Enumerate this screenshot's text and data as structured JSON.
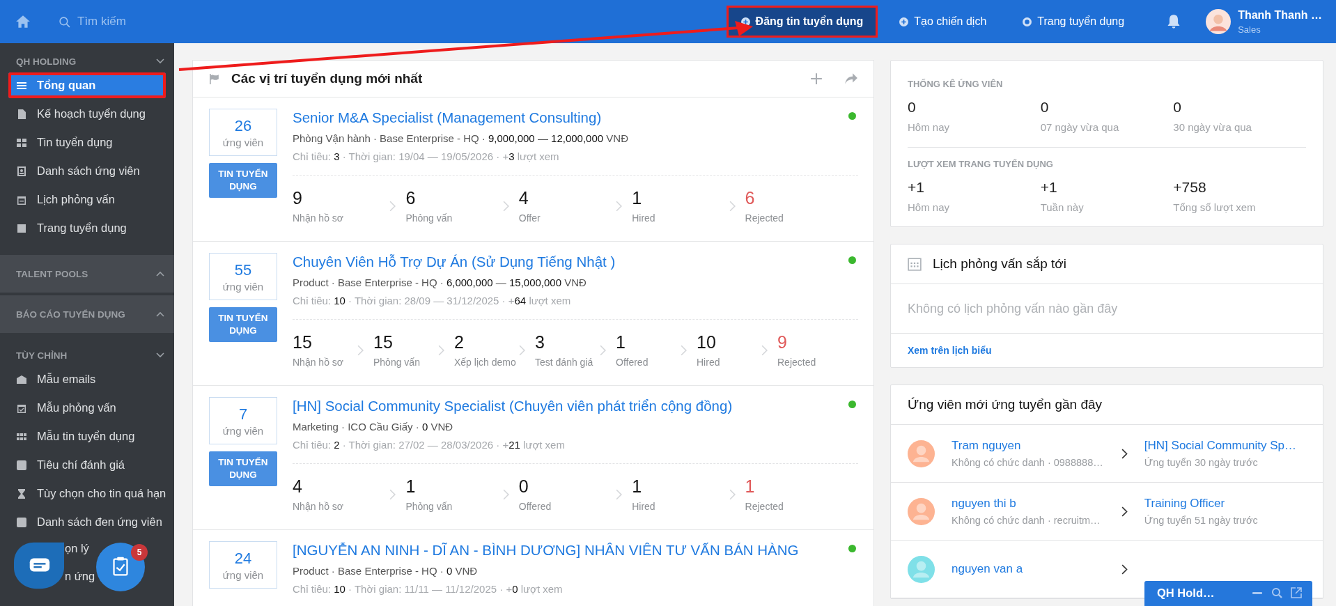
{
  "topbar": {
    "search": {
      "placeholder": "Tìm kiếm"
    },
    "actions": [
      {
        "label": "Đăng tin tuyển dụng",
        "highlighted": true
      },
      {
        "label": "Tạo chiến dịch",
        "highlighted": false
      },
      {
        "label": "Trang tuyển dụng",
        "highlighted": false
      }
    ],
    "user": {
      "name": "Thanh Thanh …",
      "role": "Sales"
    }
  },
  "sidebar": {
    "sections": [
      {
        "title": "QH HOLDING",
        "expanded": true,
        "items": [
          {
            "label": "Tổng quan",
            "kind": "full",
            "selected": true,
            "highlighted": true
          },
          {
            "label": "Kế hoạch tuyển dụng",
            "kind": "full",
            "selected": false,
            "highlighted": false
          },
          {
            "label": "Tin tuyển dụng",
            "kind": "full",
            "selected": false,
            "highlighted": false
          },
          {
            "label": "Danh sách ứng viên",
            "kind": "full",
            "selected": false,
            "highlighted": false
          },
          {
            "label": "Lịch phỏng vấn",
            "kind": "full",
            "selected": false,
            "highlighted": false
          },
          {
            "label": "Trang tuyển dụng",
            "kind": "full",
            "selected": false,
            "highlighted": false
          }
        ]
      },
      {
        "title": "TALENT POOLS",
        "expanded": false
      },
      {
        "title": "BÁO CÁO TUYỂN DỤNG",
        "expanded": false
      },
      {
        "title": "TÙY CHỈNH",
        "expanded": true,
        "items": [
          {
            "label": "Mẫu emails",
            "kind": "full",
            "selected": false,
            "highlighted": false
          },
          {
            "label": "Mẫu phỏng vấn",
            "kind": "full",
            "selected": false,
            "highlighted": false
          },
          {
            "label": "Mẫu tin tuyển dụng",
            "kind": "full",
            "selected": false,
            "highlighted": false
          },
          {
            "label": "Tiêu chí đánh giá",
            "kind": "full",
            "selected": false,
            "highlighted": false
          },
          {
            "label": "Tùy chọn cho tin quá hạn",
            "kind": "full",
            "selected": false,
            "highlighted": false
          },
          {
            "label": "Danh sách đen ứng viên",
            "kind": "full",
            "selected": false,
            "highlighted": false
          },
          {
            "label": "ọn lý",
            "kind": "partial",
            "selected": false,
            "highlighted": false
          },
          {
            "label": "n ứng",
            "kind": "partial",
            "selected": false,
            "highlighted": false
          }
        ]
      }
    ]
  },
  "jobs": {
    "title": "Các vị trí tuyển dụng mới nhất",
    "items": [
      {
        "count": "26",
        "count_label": "ứng viên",
        "button": "TIN TUYỂN DỤNG",
        "title": "Senior M&A Specialist (Management Consulting)",
        "active": true,
        "meta": "Phòng Vận hành · Base Enterprise - HQ · **9,000,000** — **12,000,000** VNĐ",
        "details": "Chỉ tiêu: **3** · Thời gian: 19/04 — 19/05/2026 · +**3** lượt xem",
        "stages": [
          {
            "count": "9",
            "label": "Nhận hồ sơ",
            "kind": "normal"
          },
          {
            "count": "6",
            "label": "Phỏng vấn",
            "kind": "normal"
          },
          {
            "count": "4",
            "label": "Offer",
            "kind": "normal"
          },
          {
            "count": "1",
            "label": "Hired",
            "kind": "normal"
          },
          {
            "count": "6",
            "label": "Rejected",
            "kind": "rejected"
          }
        ]
      },
      {
        "count": "55",
        "count_label": "ứng viên",
        "button": "TIN TUYỂN DỤNG",
        "title": "Chuyên Viên Hỗ Trợ Dự Án (Sử Dụng Tiếng Nhật )",
        "active": true,
        "meta": "Product · Base Enterprise - HQ · **6,000,000** — **15,000,000** VNĐ",
        "details": "Chỉ tiêu: **10** · Thời gian: 28/09 — 31/12/2025 · +**64** lượt xem",
        "stages": [
          {
            "count": "15",
            "label": "Nhận hồ sơ",
            "kind": "normal"
          },
          {
            "count": "15",
            "label": "Phỏng vấn",
            "kind": "normal"
          },
          {
            "count": "2",
            "label": "Xếp lịch demo",
            "kind": "normal"
          },
          {
            "count": "3",
            "label": "Test đánh giá",
            "kind": "normal"
          },
          {
            "count": "1",
            "label": "Offered",
            "kind": "normal"
          },
          {
            "count": "10",
            "label": "Hired",
            "kind": "normal"
          },
          {
            "count": "9",
            "label": "Rejected",
            "kind": "rejected"
          }
        ]
      },
      {
        "count": "7",
        "count_label": "ứng viên",
        "button": "TIN TUYỂN DỤNG",
        "title": "[HN] Social Community Specialist (Chuyên viên phát triển cộng đồng)",
        "active": true,
        "meta": "Marketing · ICO Cầu Giấy · **0** VNĐ",
        "details": "Chỉ tiêu: **2** · Thời gian: 27/02 — 28/03/2026 · +**21** lượt xem",
        "stages": [
          {
            "count": "4",
            "label": "Nhận hồ sơ",
            "kind": "normal"
          },
          {
            "count": "1",
            "label": "Phỏng vấn",
            "kind": "normal"
          },
          {
            "count": "0",
            "label": "Offered",
            "kind": "normal"
          },
          {
            "count": "1",
            "label": "Hired",
            "kind": "normal"
          },
          {
            "count": "1",
            "label": "Rejected",
            "kind": "rejected"
          }
        ]
      },
      {
        "count": "24",
        "count_label": "ứng viên",
        "title": "[NGUYỄN AN NINH - DĨ AN - BÌNH DƯƠNG] NHÂN VIÊN TƯ VẤN BÁN HÀNG",
        "active": true,
        "meta": "Product · Base Enterprise - HQ · **0** VNĐ",
        "details": "Chỉ tiêu: **10** · Thời gian: 11/11 — 11/12/2025 · +**0** lượt xem"
      }
    ]
  },
  "stats": {
    "groups": [
      {
        "title": "THỐNG KÊ ỨNG VIÊN",
        "items": [
          {
            "value": "0",
            "label": "Hôm nay"
          },
          {
            "value": "0",
            "label": "07 ngày vừa qua"
          },
          {
            "value": "0",
            "label": "30 ngày vừa qua"
          }
        ]
      },
      {
        "title": "LƯỢT XEM TRANG TUYỂN DỤNG",
        "items": [
          {
            "value": "+1",
            "label": "Hôm nay"
          },
          {
            "value": "+1",
            "label": "Tuần này"
          },
          {
            "value": "+758",
            "label": "Tổng số lượt xem"
          }
        ]
      }
    ]
  },
  "interviews": {
    "title": "Lịch phỏng vấn sắp tới",
    "empty": "Không có lịch phỏng vấn nào gần đây",
    "link": "Xem trên lịch biểu"
  },
  "applicants": {
    "title": "Ứng viên mới ứng tuyển gần đây",
    "rows": [
      {
        "name": "Tram nguyen",
        "detail": "Không có chức danh · 0988888…",
        "color": "#fdb392",
        "job": "[HN] Social Community Sp…",
        "applied": "Ứng tuyển 30 ngày trước"
      },
      {
        "name": "nguyen thi b",
        "detail": "Không có chức danh · recruitm…",
        "color": "#fdb392",
        "job": "Training Officer",
        "applied": "Ứng tuyển 51 ngày trước"
      },
      {
        "name": "nguyen van a",
        "color": "#7fe0e8"
      }
    ]
  },
  "chat_widget": {
    "title": "QH Hold…"
  },
  "tasks_badge": "5",
  "annotation": {
    "arrow": true
  }
}
